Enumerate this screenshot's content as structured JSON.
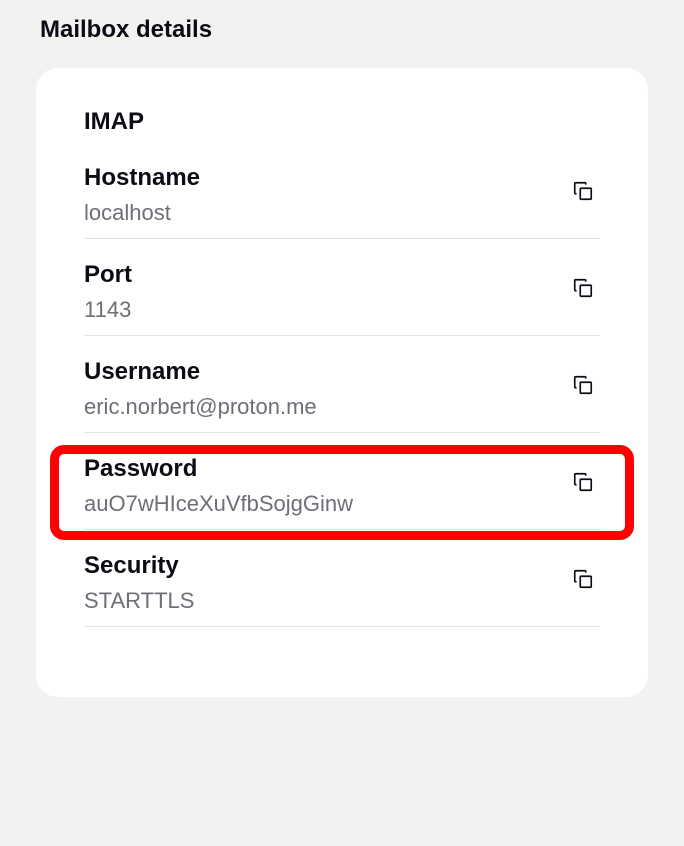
{
  "title": "Mailbox details",
  "section": "IMAP",
  "fields": {
    "hostname": {
      "label": "Hostname",
      "value": "localhost"
    },
    "port": {
      "label": "Port",
      "value": "1143"
    },
    "username": {
      "label": "Username",
      "value": "eric.norbert@proton.me"
    },
    "password": {
      "label": "Password",
      "value": "auO7wHIceXuVfbSojgGinw"
    },
    "security": {
      "label": "Security",
      "value": "STARTTLS"
    }
  }
}
